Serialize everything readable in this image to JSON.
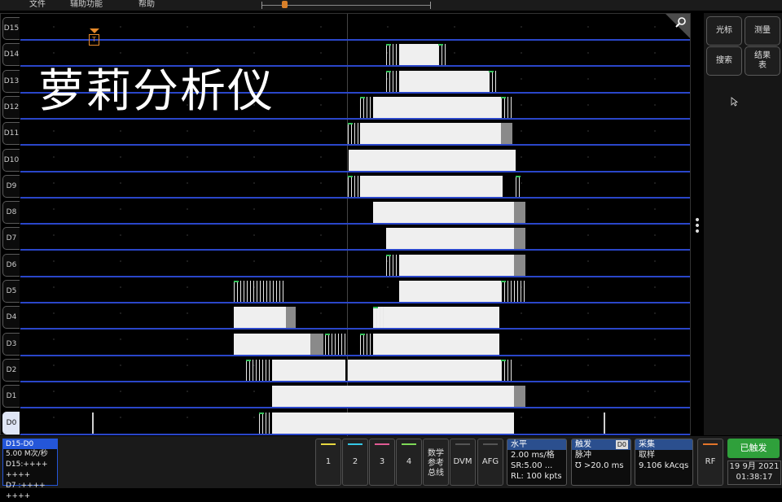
{
  "menu": {
    "file": "文件",
    "utility": "辅助功能",
    "help": "帮助"
  },
  "overlay_title": "萝莉分析仪",
  "trigger_marker": "T",
  "channels": [
    "D15",
    "D14",
    "D13",
    "D12",
    "D11",
    "D10",
    "D9",
    "D8",
    "D7",
    "D6",
    "D5",
    "D4",
    "D3",
    "D2",
    "D1",
    "D0"
  ],
  "right_buttons": {
    "cursor": "光标",
    "measure": "测量",
    "search": "搜索",
    "results": "结果\n表"
  },
  "badge": {
    "title": "D15-D0",
    "rate": "5.00 M次/秒",
    "row1": "D15:++++ ++++",
    "row2": "D7 :++++ ++++"
  },
  "channel_buttons": [
    {
      "label": "1",
      "color": "#e8d840"
    },
    {
      "label": "2",
      "color": "#35c8e6"
    },
    {
      "label": "3",
      "color": "#e05a94"
    },
    {
      "label": "4",
      "color": "#7ed957"
    }
  ],
  "math_ref_bus": "数学\n参考\n总线",
  "dvm": "DVM",
  "afg": "AFG",
  "horizontal": {
    "title": "水平",
    "row1": "2.00 ms/格",
    "row2": "SR:5.00 ...",
    "row3": "RL: 100 kpts"
  },
  "trigger": {
    "title": "触发",
    "source": "D0",
    "row1": "脉冲",
    "row2": "Ʊ >20.0 ms"
  },
  "acquire": {
    "title": "采集",
    "row1": "取样",
    "row2": "9.106 kAcqs"
  },
  "rf": "RF",
  "status": "已触发",
  "date": "19 9月 2021",
  "time": "01:38:17",
  "colors": {
    "accent": "#2456d8",
    "baseline": "#2a46c9",
    "trigger": "#e88a2a",
    "triggered": "#2fa03b"
  }
}
